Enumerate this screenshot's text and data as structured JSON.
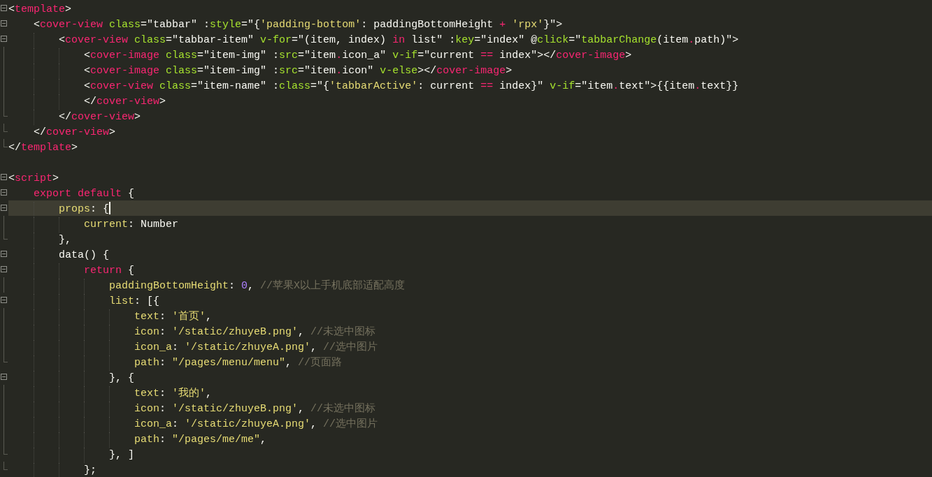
{
  "editor": {
    "lines": [
      {
        "kind": "fold_start",
        "current": false,
        "tokens": [
          {
            "kind": "plain",
            "text": "<"
          },
          {
            "kind": "tag",
            "text": "template"
          },
          {
            "kind": "plain",
            "text": ">"
          }
        ]
      },
      {
        "kind": "fold_start",
        "current": false,
        "tokens": [
          {
            "kind": "plain",
            "text": "    <"
          },
          {
            "kind": "tag",
            "text": "cover-view"
          },
          {
            "kind": "attr",
            "text": " class"
          },
          {
            "kind": "plain",
            "text": "=\"tabbar\" :"
          },
          {
            "kind": "attr",
            "text": "style"
          },
          {
            "kind": "plain",
            "text": "=\"{"
          },
          {
            "kind": "string",
            "text": "'padding-bottom'"
          },
          {
            "kind": "plain",
            "text": ": paddingBottomHeight "
          },
          {
            "kind": "tag",
            "text": "+"
          },
          {
            "kind": "string",
            "text": " 'rpx'"
          },
          {
            "kind": "plain",
            "text": "}\">"
          }
        ]
      },
      {
        "kind": "fold_start",
        "current": false,
        "tokens": [
          {
            "kind": "plain",
            "text": "        <"
          },
          {
            "kind": "tag",
            "text": "cover-view"
          },
          {
            "kind": "attr",
            "text": " class"
          },
          {
            "kind": "plain",
            "text": "=\"tabbar-item\" "
          },
          {
            "kind": "attr",
            "text": "v-for"
          },
          {
            "kind": "plain",
            "text": "=\"(item, index) "
          },
          {
            "kind": "tag",
            "text": "in"
          },
          {
            "kind": "plain",
            "text": " list\" :"
          },
          {
            "kind": "attr",
            "text": "key"
          },
          {
            "kind": "plain",
            "text": "=\"index\" @"
          },
          {
            "kind": "attr",
            "text": "click"
          },
          {
            "kind": "plain",
            "text": "=\""
          },
          {
            "kind": "attr",
            "text": "tabbarChange"
          },
          {
            "kind": "plain",
            "text": "(item"
          },
          {
            "kind": "tag",
            "text": "."
          },
          {
            "kind": "plain",
            "text": "path)\">"
          }
        ]
      },
      {
        "kind": "fold_body",
        "current": false,
        "tokens": [
          {
            "kind": "plain",
            "text": "            <"
          },
          {
            "kind": "tag",
            "text": "cover-image"
          },
          {
            "kind": "attr",
            "text": " class"
          },
          {
            "kind": "plain",
            "text": "=\"item-img\" :"
          },
          {
            "kind": "attr",
            "text": "src"
          },
          {
            "kind": "plain",
            "text": "=\"item"
          },
          {
            "kind": "tag",
            "text": "."
          },
          {
            "kind": "plain",
            "text": "icon_a\" "
          },
          {
            "kind": "attr",
            "text": "v-if"
          },
          {
            "kind": "plain",
            "text": "=\"current "
          },
          {
            "kind": "tag",
            "text": "=="
          },
          {
            "kind": "plain",
            "text": " index\"></"
          },
          {
            "kind": "tag",
            "text": "cover-image"
          },
          {
            "kind": "plain",
            "text": ">"
          }
        ]
      },
      {
        "kind": "fold_body",
        "current": false,
        "tokens": [
          {
            "kind": "plain",
            "text": "            <"
          },
          {
            "kind": "tag",
            "text": "cover-image"
          },
          {
            "kind": "attr",
            "text": " class"
          },
          {
            "kind": "plain",
            "text": "=\"item-img\" :"
          },
          {
            "kind": "attr",
            "text": "src"
          },
          {
            "kind": "plain",
            "text": "=\"item"
          },
          {
            "kind": "tag",
            "text": "."
          },
          {
            "kind": "plain",
            "text": "icon\" "
          },
          {
            "kind": "attr",
            "text": "v-else"
          },
          {
            "kind": "plain",
            "text": "></"
          },
          {
            "kind": "tag",
            "text": "cover-image"
          },
          {
            "kind": "plain",
            "text": ">"
          }
        ]
      },
      {
        "kind": "fold_body",
        "current": false,
        "tokens": [
          {
            "kind": "plain",
            "text": "            <"
          },
          {
            "kind": "tag",
            "text": "cover-view"
          },
          {
            "kind": "attr",
            "text": " class"
          },
          {
            "kind": "plain",
            "text": "=\"item-name\" :"
          },
          {
            "kind": "attr",
            "text": "class"
          },
          {
            "kind": "plain",
            "text": "=\"{"
          },
          {
            "kind": "string",
            "text": "'tabbarActive'"
          },
          {
            "kind": "plain",
            "text": ": current "
          },
          {
            "kind": "tag",
            "text": "=="
          },
          {
            "kind": "plain",
            "text": " index}\" "
          },
          {
            "kind": "attr",
            "text": "v-if"
          },
          {
            "kind": "plain",
            "text": "=\"item"
          },
          {
            "kind": "tag",
            "text": "."
          },
          {
            "kind": "plain",
            "text": "text\">{{item"
          },
          {
            "kind": "tag",
            "text": "."
          },
          {
            "kind": "plain",
            "text": "text}}"
          }
        ]
      },
      {
        "kind": "fold_body",
        "current": false,
        "tokens": [
          {
            "kind": "plain",
            "text": "            </"
          },
          {
            "kind": "tag",
            "text": "cover-view"
          },
          {
            "kind": "plain",
            "text": ">"
          }
        ]
      },
      {
        "kind": "fold_end",
        "current": false,
        "tokens": [
          {
            "kind": "plain",
            "text": "        </"
          },
          {
            "kind": "tag",
            "text": "cover-view"
          },
          {
            "kind": "plain",
            "text": ">"
          }
        ]
      },
      {
        "kind": "fold_end",
        "current": false,
        "tokens": [
          {
            "kind": "plain",
            "text": "    </"
          },
          {
            "kind": "tag",
            "text": "cover-view"
          },
          {
            "kind": "plain",
            "text": ">"
          }
        ]
      },
      {
        "kind": "fold_end",
        "current": false,
        "tokens": [
          {
            "kind": "plain",
            "text": "</"
          },
          {
            "kind": "tag",
            "text": "template"
          },
          {
            "kind": "plain",
            "text": ">"
          }
        ]
      },
      {
        "current": false
      },
      {
        "kind": "fold_start",
        "current": false,
        "tokens": [
          {
            "kind": "plain",
            "text": "<"
          },
          {
            "kind": "tag",
            "text": "script"
          },
          {
            "kind": "plain",
            "text": ">"
          }
        ]
      },
      {
        "kind": "fold_start",
        "current": false,
        "tokens": [
          {
            "kind": "tag",
            "text": "    export default"
          },
          {
            "kind": "plain",
            "text": " {"
          }
        ]
      },
      {
        "kind": "fold_start",
        "current": true,
        "tokens": [
          {
            "kind": "string",
            "text": "        props"
          },
          {
            "kind": "plain",
            "text": ": {"
          }
        ]
      },
      {
        "kind": "fold_body",
        "current": false,
        "tokens": [
          {
            "kind": "string",
            "text": "            current"
          },
          {
            "kind": "plain",
            "text": ": Number"
          }
        ]
      },
      {
        "kind": "fold_end",
        "current": false,
        "tokens": [
          {
            "kind": "plain",
            "text": "        },"
          }
        ]
      },
      {
        "kind": "fold_start",
        "current": false,
        "tokens": [
          {
            "kind": "plain",
            "text": "        data() {"
          }
        ]
      },
      {
        "kind": "fold_start",
        "current": false,
        "tokens": [
          {
            "kind": "tag",
            "text": "            return"
          },
          {
            "kind": "plain",
            "text": " {"
          }
        ]
      },
      {
        "kind": "fold_body",
        "current": false,
        "tokens": [
          {
            "kind": "string",
            "text": "                paddingBottomHeight"
          },
          {
            "kind": "plain",
            "text": ": "
          },
          {
            "kind": "number",
            "text": "0"
          },
          {
            "kind": "plain",
            "text": ", "
          },
          {
            "kind": "comment",
            "text": "//苹果X以上手机底部适配高度"
          }
        ]
      },
      {
        "kind": "fold_start",
        "current": false,
        "tokens": [
          {
            "kind": "string",
            "text": "                list"
          },
          {
            "kind": "plain",
            "text": ": [{"
          }
        ]
      },
      {
        "kind": "fold_body",
        "current": false,
        "tokens": [
          {
            "kind": "string",
            "text": "                    text"
          },
          {
            "kind": "plain",
            "text": ": "
          },
          {
            "kind": "string",
            "text": "'首页'"
          },
          {
            "kind": "plain",
            "text": ","
          }
        ]
      },
      {
        "kind": "fold_body",
        "current": false,
        "tokens": [
          {
            "kind": "string",
            "text": "                    icon"
          },
          {
            "kind": "plain",
            "text": ": "
          },
          {
            "kind": "string",
            "text": "'/static/zhuyeB.png'"
          },
          {
            "kind": "plain",
            "text": ", "
          },
          {
            "kind": "comment",
            "text": "//未选中图标"
          }
        ]
      },
      {
        "kind": "fold_body",
        "current": false,
        "tokens": [
          {
            "kind": "string",
            "text": "                    icon_a"
          },
          {
            "kind": "plain",
            "text": ": "
          },
          {
            "kind": "string",
            "text": "'/static/zhuyeA.png'"
          },
          {
            "kind": "plain",
            "text": ", "
          },
          {
            "kind": "comment",
            "text": "//选中图片"
          }
        ]
      },
      {
        "kind": "fold_end",
        "current": false,
        "tokens": [
          {
            "kind": "string",
            "text": "                    path"
          },
          {
            "kind": "plain",
            "text": ": "
          },
          {
            "kind": "string",
            "text": "\"/pages/menu/menu\""
          },
          {
            "kind": "plain",
            "text": ", "
          },
          {
            "kind": "comment",
            "text": "//页面路"
          }
        ]
      },
      {
        "kind": "fold_start",
        "current": false,
        "tokens": [
          {
            "kind": "plain",
            "text": "                }, {"
          }
        ]
      },
      {
        "kind": "fold_body",
        "current": false,
        "tokens": [
          {
            "kind": "string",
            "text": "                    text"
          },
          {
            "kind": "plain",
            "text": ": "
          },
          {
            "kind": "string",
            "text": "'我的'"
          },
          {
            "kind": "plain",
            "text": ","
          }
        ]
      },
      {
        "kind": "fold_body",
        "current": false,
        "tokens": [
          {
            "kind": "string",
            "text": "                    icon"
          },
          {
            "kind": "plain",
            "text": ": "
          },
          {
            "kind": "string",
            "text": "'/static/zhuyeB.png'"
          },
          {
            "kind": "plain",
            "text": ", "
          },
          {
            "kind": "comment",
            "text": "//未选中图标"
          }
        ]
      },
      {
        "kind": "fold_body",
        "current": false,
        "tokens": [
          {
            "kind": "string",
            "text": "                    icon_a"
          },
          {
            "kind": "plain",
            "text": ": "
          },
          {
            "kind": "string",
            "text": "'/static/zhuyeA.png'"
          },
          {
            "kind": "plain",
            "text": ", "
          },
          {
            "kind": "comment",
            "text": "//选中图片"
          }
        ]
      },
      {
        "kind": "fold_body",
        "current": false,
        "tokens": [
          {
            "kind": "string",
            "text": "                    path"
          },
          {
            "kind": "plain",
            "text": ": "
          },
          {
            "kind": "string",
            "text": "\"/pages/me/me\""
          },
          {
            "kind": "plain",
            "text": ","
          }
        ]
      },
      {
        "kind": "fold_end",
        "current": false,
        "tokens": [
          {
            "kind": "plain",
            "text": "                }, ]"
          }
        ]
      },
      {
        "kind": "fold_end",
        "current": false,
        "tokens": [
          {
            "kind": "plain",
            "text": "            };"
          }
        ]
      }
    ]
  }
}
